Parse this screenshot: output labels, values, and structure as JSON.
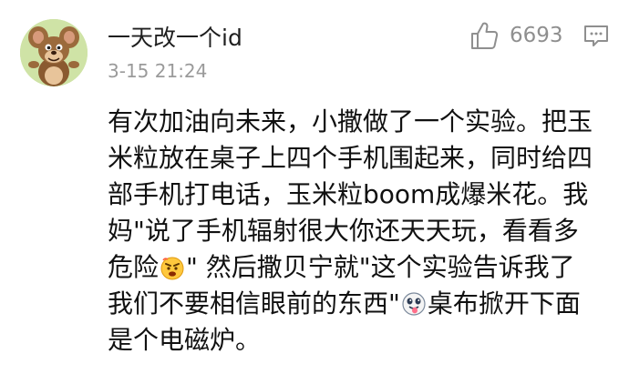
{
  "comment": {
    "username": "一天改一个id",
    "timestamp": "3-15 21:24",
    "likes": "6693",
    "body_lines": [
      "有次加油向未来，小撒做了一个实验。把玉",
      "米粒放在桌子上四个手机围起来，同时给四",
      "部手机打电话，玉米粒boom成爆米花。我",
      "妈\"说了手机辐射很大你还天天玩，看看多",
      "危险|\"  然后撒贝宁就\"这个实验告诉我了",
      "我们不要相信眼前的东西\"|桌布掀开下面",
      "是个电磁炉。"
    ],
    "line5_before_emoji": "危险",
    "line5_after_emoji": "\"  然后撒贝宁就\"这个实验告诉我了",
    "line6_before_emoji": "我们不要相信眼前的东西\"",
    "line6_after_emoji": "桌布掀开下面",
    "emoji_names": [
      "angry-face-emoji",
      "tongue-out-emoji"
    ],
    "avatar_icon": "cartoon-mouse-avatar",
    "like_icon": "thumbs-up-icon",
    "reply_icon": "comment-reply-icon"
  },
  "colors": {
    "text_primary": "#111111",
    "text_secondary": "#9a9a9a",
    "icon_gray": "#8f8f8f"
  }
}
